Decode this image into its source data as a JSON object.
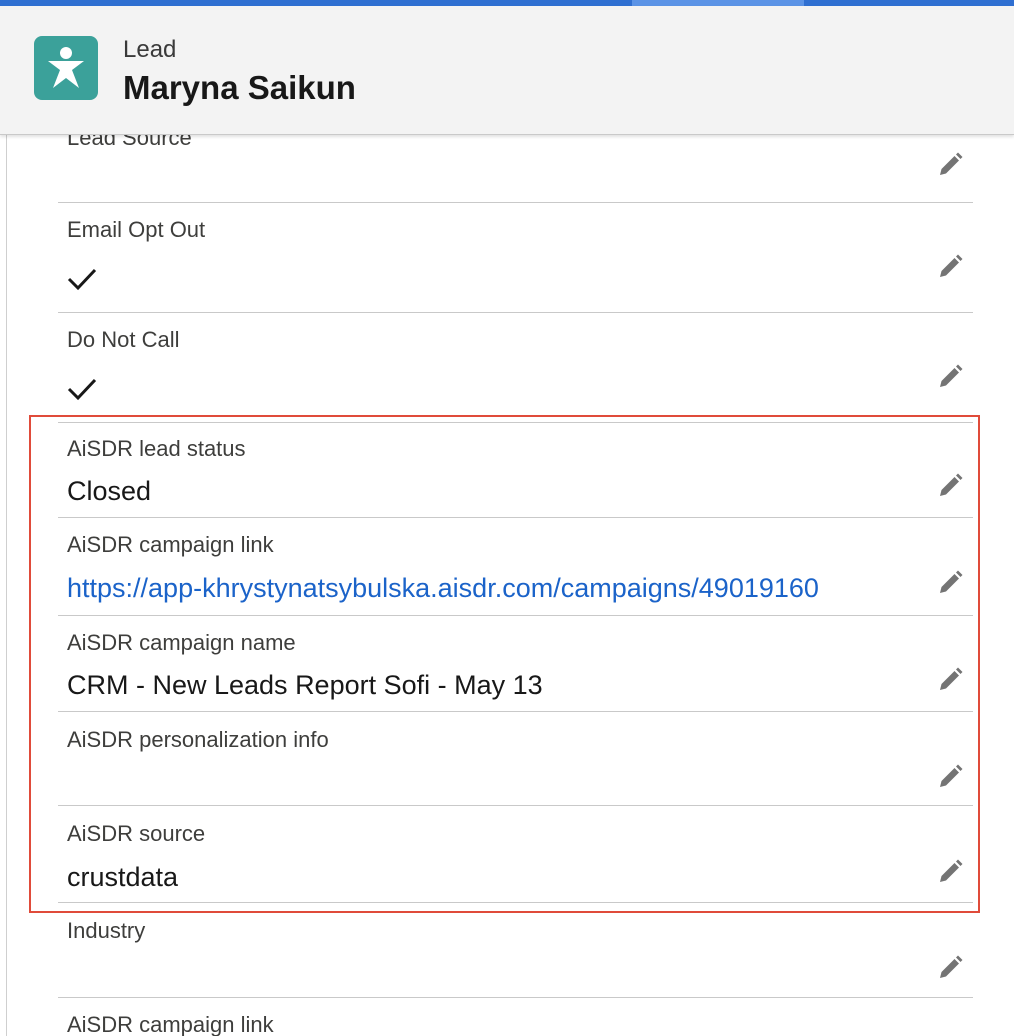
{
  "header": {
    "entity_type": "Lead",
    "record_name": "Maryna Saikun",
    "icon": "lead-person-icon",
    "icon_color": "#3ba19a"
  },
  "fields": [
    {
      "label": "Lead Source",
      "value": ""
    },
    {
      "label": "Email Opt Out",
      "checked": true
    },
    {
      "label": "Do Not Call",
      "checked": true
    },
    {
      "label": "AiSDR lead status",
      "value": "Closed"
    },
    {
      "label": "AiSDR campaign link",
      "value": "https://app-khrystynatsybulska.aisdr.com/campaigns/49019160"
    },
    {
      "label": "AiSDR campaign name",
      "value": "CRM - New Leads Report Sofi - May 13"
    },
    {
      "label": "AiSDR personalization info",
      "value": ""
    },
    {
      "label": "AiSDR source",
      "value": "crustdata"
    },
    {
      "label": "Industry",
      "value": ""
    },
    {
      "label": "AiSDR campaign link",
      "value": ""
    }
  ],
  "colors": {
    "accent": "#2f6fd1",
    "link": "#1b63c9",
    "highlight": "#e04b3a"
  }
}
